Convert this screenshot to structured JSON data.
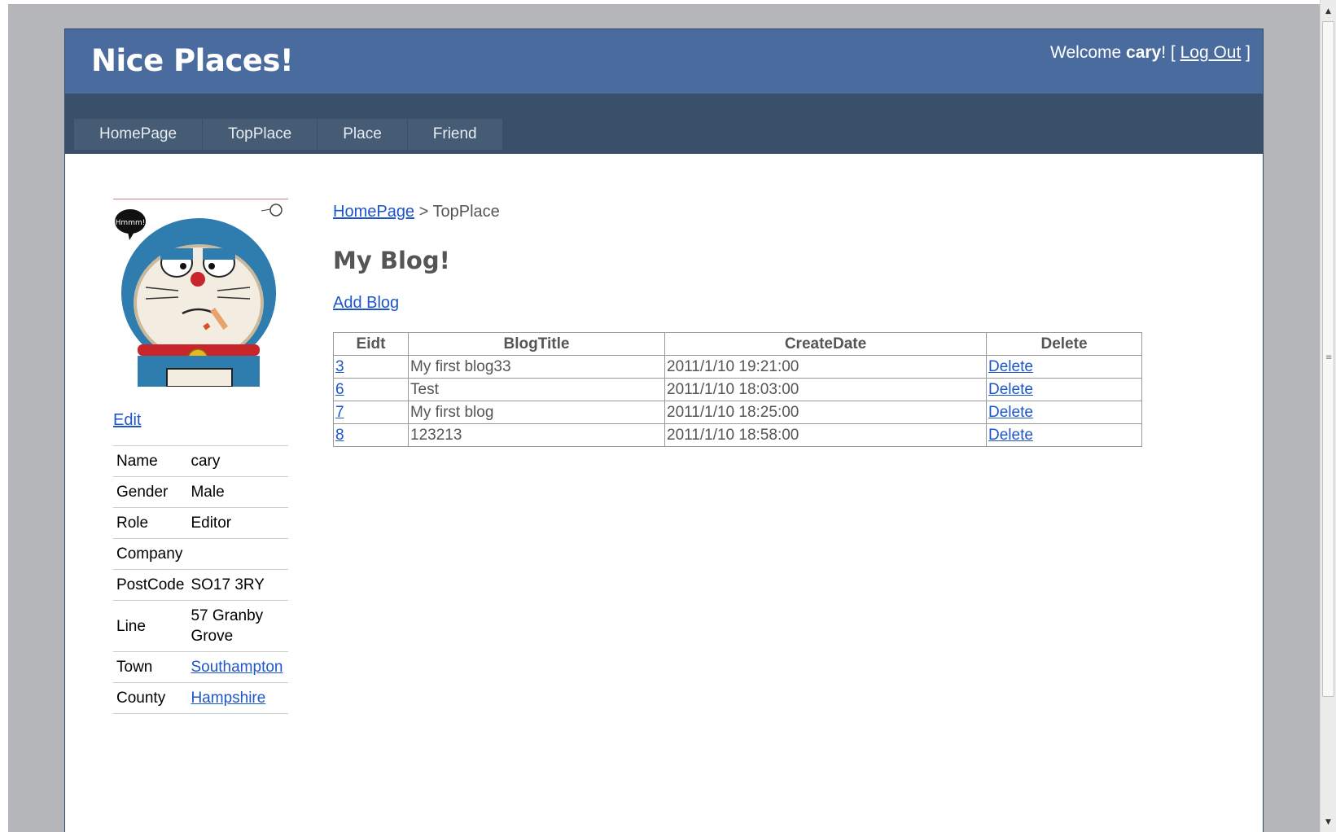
{
  "header": {
    "title": "Nice Places!",
    "welcome_prefix": "Welcome ",
    "username": "cary",
    "welcome_suffix": "! [ ",
    "logout_label": "Log Out",
    "bracket_close": " ]"
  },
  "menu": [
    {
      "label": "HomePage"
    },
    {
      "label": "TopPlace"
    },
    {
      "label": "Place"
    },
    {
      "label": "Friend"
    }
  ],
  "avatar": {
    "bubble_text": "Hmmm!"
  },
  "sidebar": {
    "edit_label": "Edit",
    "profile": [
      {
        "key": "Name",
        "value": "cary"
      },
      {
        "key": "Gender",
        "value": "Male"
      },
      {
        "key": "Role",
        "value": "Editor"
      },
      {
        "key": "Company",
        "value": ""
      },
      {
        "key": "PostCode",
        "value": "SO17 3RY"
      },
      {
        "key": "Line",
        "value": "57 Granby Grove"
      },
      {
        "key": "Town",
        "value": "Southampton"
      },
      {
        "key": "County",
        "value": "Hampshire"
      }
    ]
  },
  "breadcrumb": {
    "home": "HomePage",
    "separator": " > ",
    "current": "TopPlace"
  },
  "main": {
    "heading": "My Blog!",
    "add_blog_label": "Add Blog",
    "table": {
      "headers": [
        "Eidt",
        "BlogTitle",
        "CreateDate",
        "Delete"
      ],
      "rows": [
        {
          "id": "3",
          "title": "My first blog33",
          "date": "2011/1/10 19:21:00",
          "delete": "Delete"
        },
        {
          "id": "6",
          "title": "Test",
          "date": "2011/1/10 18:03:00",
          "delete": "Delete"
        },
        {
          "id": "7",
          "title": "My first blog",
          "date": "2011/1/10 18:25:00",
          "delete": "Delete"
        },
        {
          "id": "8",
          "title": "123213",
          "date": "2011/1/10 18:58:00",
          "delete": "Delete"
        }
      ]
    }
  },
  "scrollbar": {
    "grip_glyph": "≡",
    "up_glyph": "▲",
    "down_glyph": "▼"
  },
  "colors": {
    "header_bg": "#4a6b9e",
    "nav_bg": "#3a5068",
    "link": "#1d56c9"
  }
}
